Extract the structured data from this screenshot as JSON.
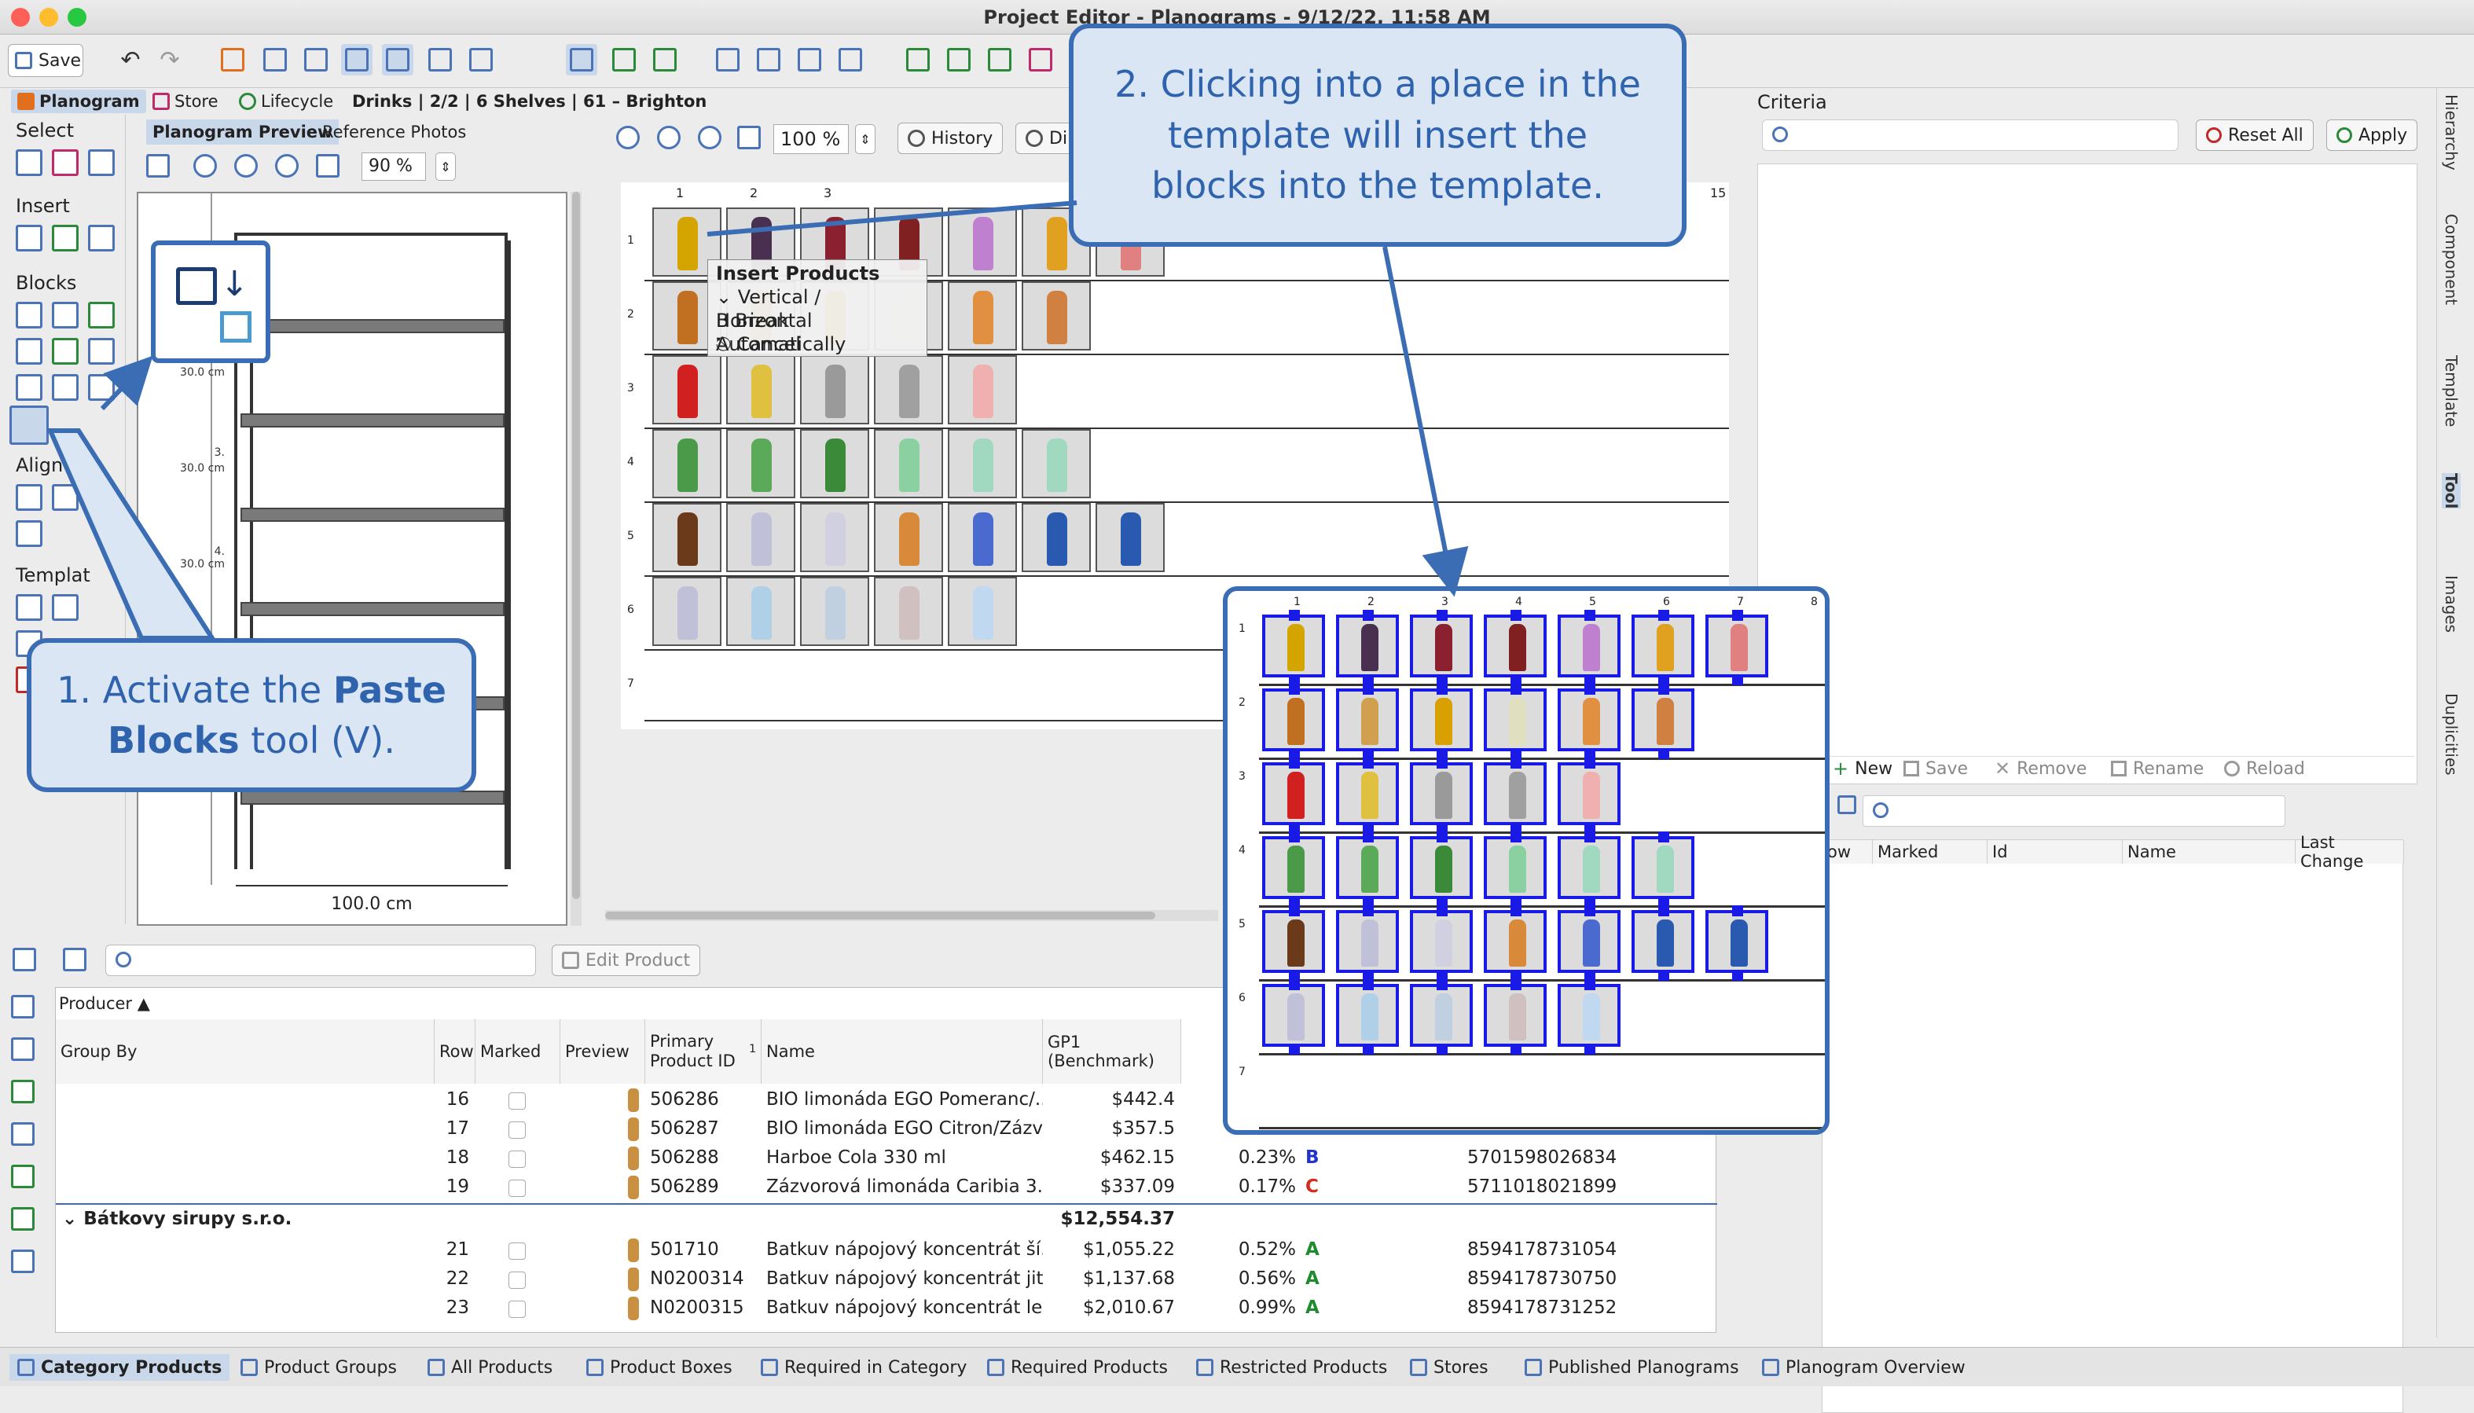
{
  "window": {
    "title": "Project Editor - Planograms - 9/12/22, 11:58 AM"
  },
  "toolbar": {
    "save_label": "Save"
  },
  "nav_tabs": [
    {
      "label": "Planogram",
      "icon": "planogram-icon"
    },
    {
      "label": "Store",
      "icon": "store-icon"
    },
    {
      "label": "Lifecycle",
      "icon": "lifecycle-icon"
    }
  ],
  "breadcrumb": "Drinks | 2/2 | 6 Shelves | 61 – Brighton",
  "left_panel": {
    "select": "Select",
    "insert": "Insert",
    "blocks": "Blocks",
    "align": "Align",
    "template": "Templat"
  },
  "preview": {
    "tab_preview": "Planogram Preview",
    "tab_photos": "Reference Photos",
    "zoom": "90 %",
    "width_label": "100.0 cm",
    "cm_labels": [
      "30.0 cm",
      "30.0 cm",
      "30.0 cm"
    ],
    "shelf_nums": [
      "3.",
      "4."
    ]
  },
  "planogram": {
    "zoom": "100 %",
    "history": "History",
    "di_label": "Di",
    "col_nums": [
      "1",
      "2",
      "3"
    ],
    "col_last": "15",
    "row_nums": [
      "1",
      "2",
      "3",
      "4",
      "5",
      "6",
      "7"
    ]
  },
  "context_menu": {
    "title": "Insert Products",
    "items": [
      "Vertical / Horizontal",
      "Break Automatically",
      "Cancel"
    ],
    "keys": [
      "⌄",
      "B",
      "⎋"
    ]
  },
  "inset": {
    "col_nums": [
      "1",
      "2",
      "3",
      "4",
      "5",
      "6",
      "7",
      "8"
    ],
    "row_nums": [
      "1",
      "2",
      "3",
      "4",
      "5",
      "6",
      "7"
    ]
  },
  "criteria": {
    "title": "Criteria",
    "reset_all": "Reset All",
    "apply": "Apply"
  },
  "right_lower": {
    "new": "New",
    "save": "Save",
    "remove": "Remove",
    "rename": "Rename",
    "reload": "Reload",
    "cols": [
      "ow",
      "Marked",
      "Id",
      "Name",
      "Last Change"
    ]
  },
  "side_tabs": [
    "Hierarchy",
    "Component",
    "Template",
    "Tool",
    "Images",
    "Duplicities"
  ],
  "products_table": {
    "edit_product": "Edit Product",
    "producer_header": "Producer",
    "headers": {
      "group_by": "Group By",
      "row": "Row",
      "marked": "Marked",
      "preview": "Preview",
      "primary_id": "Primary Product ID",
      "sort_num": "1",
      "name": "Name",
      "gp1": "GP1 (Benchmark)"
    },
    "rows": [
      {
        "row": "16",
        "id": "506286",
        "name": "BIO limonáda EGO Pomeranc/...",
        "gp": "$442.4",
        "pct": "",
        "cls": "",
        "ean": ""
      },
      {
        "row": "17",
        "id": "506287",
        "name": "BIO limonáda EGO Citron/Zázv...",
        "gp": "$357.5",
        "pct": "",
        "cls": "",
        "ean": ""
      },
      {
        "row": "18",
        "id": "506288",
        "name": "Harboe Cola 330 ml",
        "gp": "$462.15",
        "pct": "0.23%",
        "cls": "B",
        "ean": "5701598026834"
      },
      {
        "row": "19",
        "id": "506289",
        "name": "Zázvorová limonáda Caribia 3...",
        "gp": "$337.09",
        "pct": "0.17%",
        "cls": "C",
        "ean": "5711018021899"
      }
    ],
    "group": {
      "name": "Bátkovy sirupy s.r.o.",
      "total": "$12,554.37"
    },
    "rows2": [
      {
        "row": "21",
        "id": "501710",
        "name": "Batkuv nápojový koncentrát ší...",
        "gp": "$1,055.22",
        "pct": "0.52%",
        "cls": "A",
        "ean": "8594178731054"
      },
      {
        "row": "22",
        "id": "N0200314",
        "name": "Batkuv nápojový koncentrát jit...",
        "gp": "$1,137.68",
        "pct": "0.56%",
        "cls": "A",
        "ean": "8594178730750"
      },
      {
        "row": "23",
        "id": "N0200315",
        "name": "Batkuv nápojový koncentrát le...",
        "gp": "$2,010.67",
        "pct": "0.99%",
        "cls": "A",
        "ean": "8594178731252"
      }
    ]
  },
  "status_tabs": [
    "Category Products",
    "Product Groups",
    "All Products",
    "Product Boxes",
    "Required in Category",
    "Required Products",
    "Restricted Products",
    "Stores",
    "Published Planograms",
    "Planogram Overview"
  ],
  "callouts": {
    "c1_pre": "1. Activate the ",
    "c1_bold": "Paste Blocks",
    "c1_post": " tool (V).",
    "c2": "2. Clicking into a place in the template will insert the blocks into the template."
  },
  "colors": {
    "accent": "#3a6db4",
    "callout_bg": "#dbe6f4",
    "class_a": "#1e8c2e",
    "class_b": "#2233cc",
    "class_c": "#d62a1a"
  }
}
